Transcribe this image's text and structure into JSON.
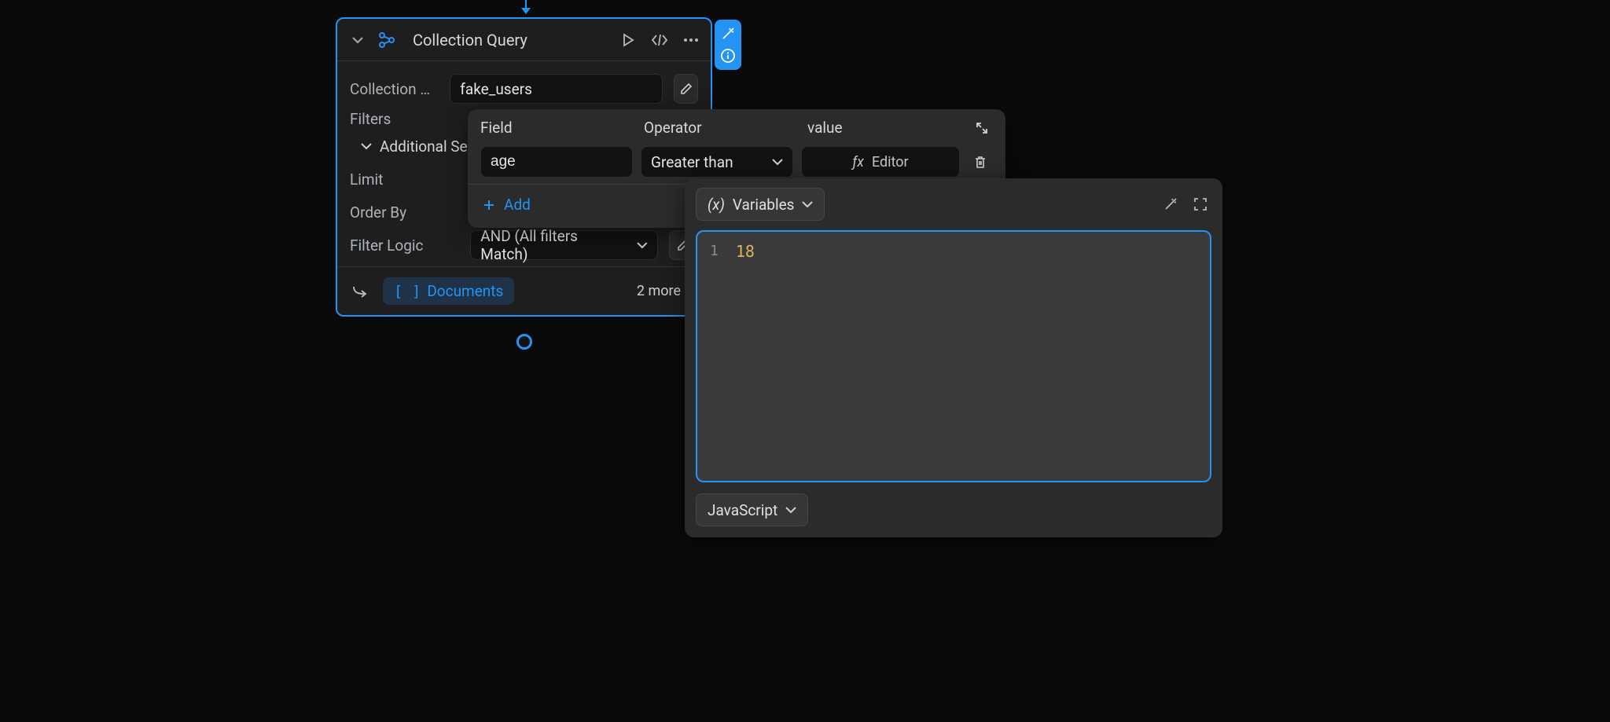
{
  "node": {
    "title": "Collection Query",
    "collection_name_label": "Collection Na…",
    "collection_name_value": "fake_users",
    "filters_label": "Filters",
    "additional_label": "Additional Se…",
    "limit_label": "Limit",
    "order_by_label": "Order By",
    "filter_logic_label": "Filter Logic",
    "filter_logic_value": "AND (All filters Match)",
    "documents_label": "Documents",
    "more_label": "2 more"
  },
  "filter_popup": {
    "head_field": "Field",
    "head_operator": "Operator",
    "head_value": "value",
    "row_field": "age",
    "row_operator": "Greater than",
    "row_value": "Editor",
    "add_label": "Add"
  },
  "editor": {
    "variables_label": "Variables",
    "line_number": "1",
    "code": "18",
    "language": "JavaScript"
  }
}
